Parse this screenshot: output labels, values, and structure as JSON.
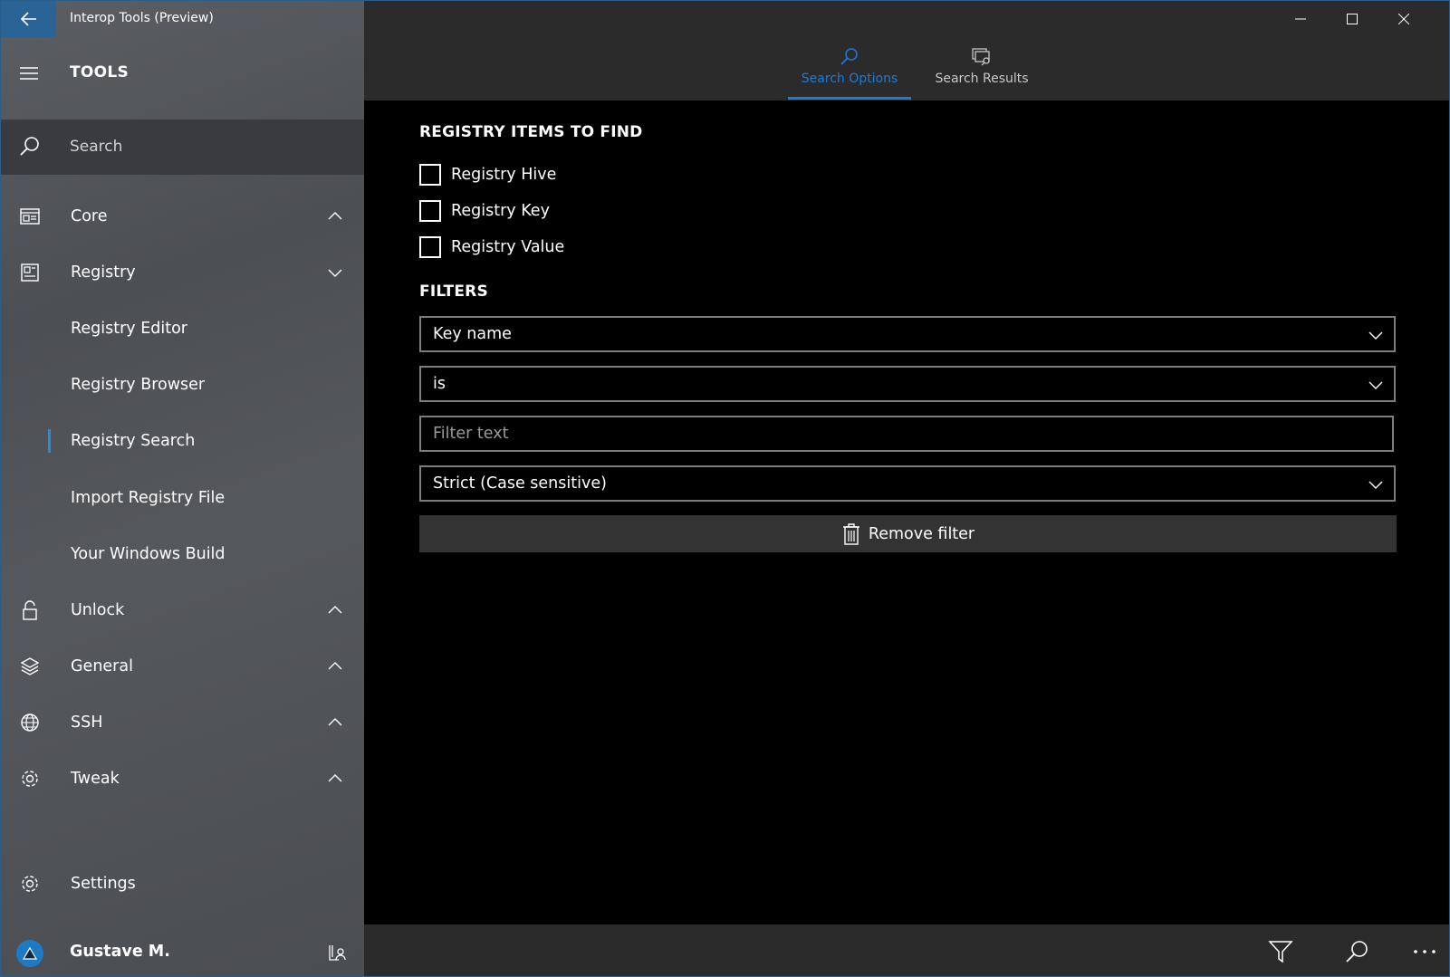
{
  "window": {
    "title": "Interop Tools (Preview)",
    "accent": "#2a6496",
    "highlight": "#1f7ad2"
  },
  "sidebar": {
    "header": "TOOLS",
    "search_placeholder": "Search",
    "groups": [
      {
        "label": "Core",
        "icon": "dashboard-icon",
        "expanded": false
      },
      {
        "label": "Registry",
        "icon": "registry-icon",
        "expanded": true
      }
    ],
    "registry_items": [
      {
        "label": "Registry Editor"
      },
      {
        "label": "Registry Browser"
      },
      {
        "label": "Registry Search",
        "selected": true
      },
      {
        "label": "Import Registry File"
      },
      {
        "label": "Your Windows Build"
      }
    ],
    "more_groups": [
      {
        "label": "Unlock",
        "icon": "lock-icon"
      },
      {
        "label": "General",
        "icon": "layers-icon"
      },
      {
        "label": "SSH",
        "icon": "globe-icon"
      },
      {
        "label": "Tweak",
        "icon": "gear-icon"
      }
    ],
    "settings_label": "Settings",
    "user_name": "Gustave M."
  },
  "tabs": [
    {
      "label": "Search Options",
      "active": true
    },
    {
      "label": "Search Results",
      "active": false
    }
  ],
  "main": {
    "items_title": "REGISTRY ITEMS TO FIND",
    "checkboxes": [
      {
        "label": "Registry Hive",
        "checked": false
      },
      {
        "label": "Registry Key",
        "checked": false
      },
      {
        "label": "Registry Value",
        "checked": false
      }
    ],
    "filters_title": "FILTERS",
    "filter_field": "Key name",
    "filter_operator": "is",
    "filter_text_placeholder": "Filter text",
    "filter_mode": "Strict (Case sensitive)",
    "remove_filter_label": "Remove filter"
  }
}
